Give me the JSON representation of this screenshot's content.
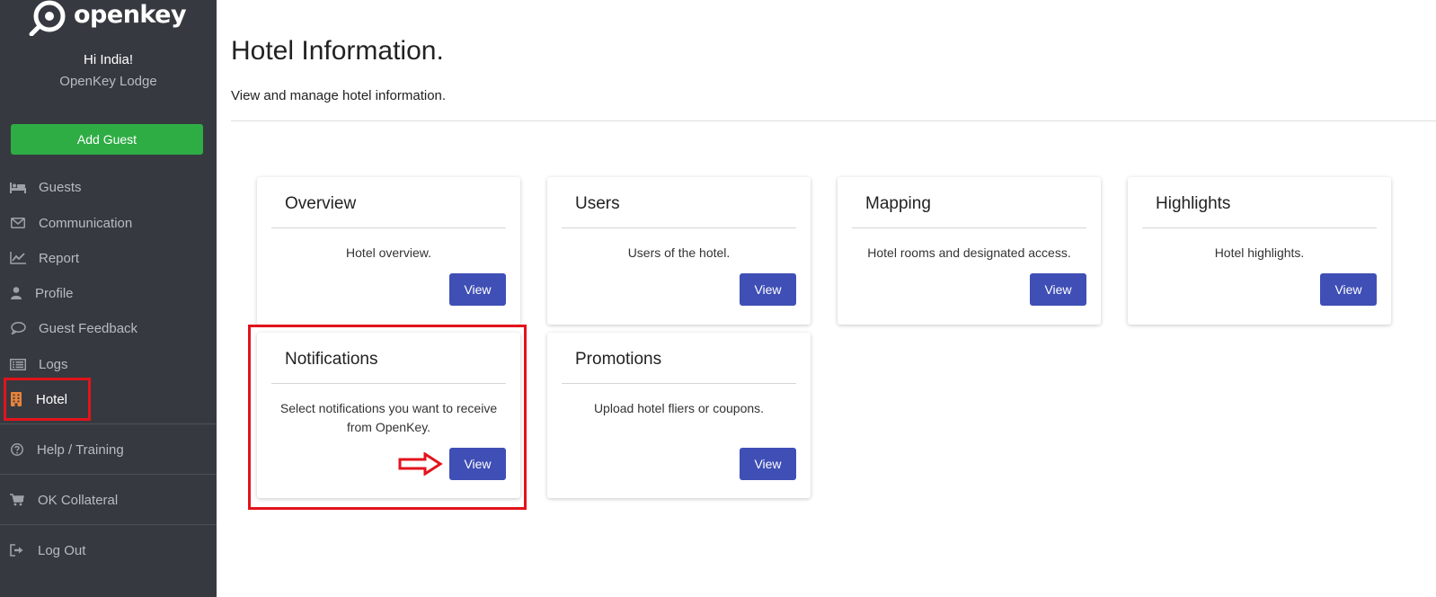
{
  "brand": {
    "name": "openkey"
  },
  "user": {
    "greeting": "Hi India!",
    "property": "OpenKey Lodge"
  },
  "sidebar": {
    "add_guest_label": "Add Guest",
    "items": [
      {
        "label": "Guests",
        "icon": "bed-icon"
      },
      {
        "label": "Communication",
        "icon": "envelope-icon"
      },
      {
        "label": "Report",
        "icon": "line-chart-icon"
      },
      {
        "label": "Profile",
        "icon": "user-icon"
      },
      {
        "label": "Guest Feedback",
        "icon": "comment-icon"
      },
      {
        "label": "Logs",
        "icon": "list-icon"
      },
      {
        "label": "Hotel",
        "icon": "building-icon",
        "active": true
      },
      {
        "label": "Help / Training",
        "icon": "question-circle-icon"
      },
      {
        "label": "OK Collateral",
        "icon": "cart-icon"
      },
      {
        "label": "Log Out",
        "icon": "sign-out-icon"
      }
    ]
  },
  "page": {
    "title": "Hotel Information.",
    "subtitle": "View and manage hotel information."
  },
  "cards": [
    {
      "title": "Overview",
      "description": "Hotel overview.",
      "button": "View"
    },
    {
      "title": "Users",
      "description": "Users of the hotel.",
      "button": "View"
    },
    {
      "title": "Mapping",
      "description": "Hotel rooms and designated access.",
      "button": "View"
    },
    {
      "title": "Highlights",
      "description": "Hotel highlights.",
      "button": "View"
    },
    {
      "title": "Notifications",
      "description": "Select notifications you want to receive from OpenKey.",
      "button": "View"
    },
    {
      "title": "Promotions",
      "description": "Upload hotel fliers or coupons.",
      "button": "View"
    }
  ],
  "colors": {
    "sidebar_bg": "#363a40",
    "add_guest": "#2ead45",
    "button_primary": "#3f4fb5",
    "annotation": "#e3131b",
    "hotel_icon": "#e8833a"
  }
}
